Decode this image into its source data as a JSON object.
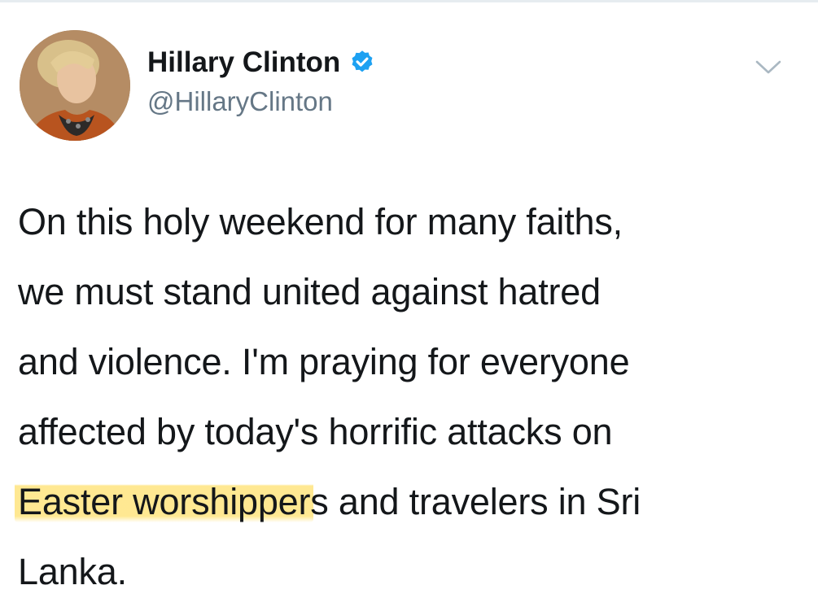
{
  "tweet": {
    "author": {
      "display_name": "Hillary Clinton",
      "handle": "@HillaryClinton",
      "verified": true,
      "avatar_icon": "profile-photo"
    },
    "more_icon": "chevron-down-icon",
    "text_lines": [
      {
        "before": "On this holy weekend for many faiths,",
        "highlighted": "",
        "after": ""
      },
      {
        "before": "we must stand united against hatred",
        "highlighted": "",
        "after": ""
      },
      {
        "before": "and violence. I'm praying for everyone",
        "highlighted": "",
        "after": ""
      },
      {
        "before": "affected by today's horrific attacks on",
        "highlighted": "",
        "after": ""
      },
      {
        "before": "",
        "highlighted": "Easter worshipper",
        "after": "s and travelers in Sri"
      },
      {
        "before": "Lanka.",
        "highlighted": "",
        "after": ""
      }
    ],
    "highlight_color": "#ffe16e"
  },
  "colors": {
    "primary_text": "#14171a",
    "secondary_text": "#657786",
    "verified_blue": "#1da1f2"
  }
}
